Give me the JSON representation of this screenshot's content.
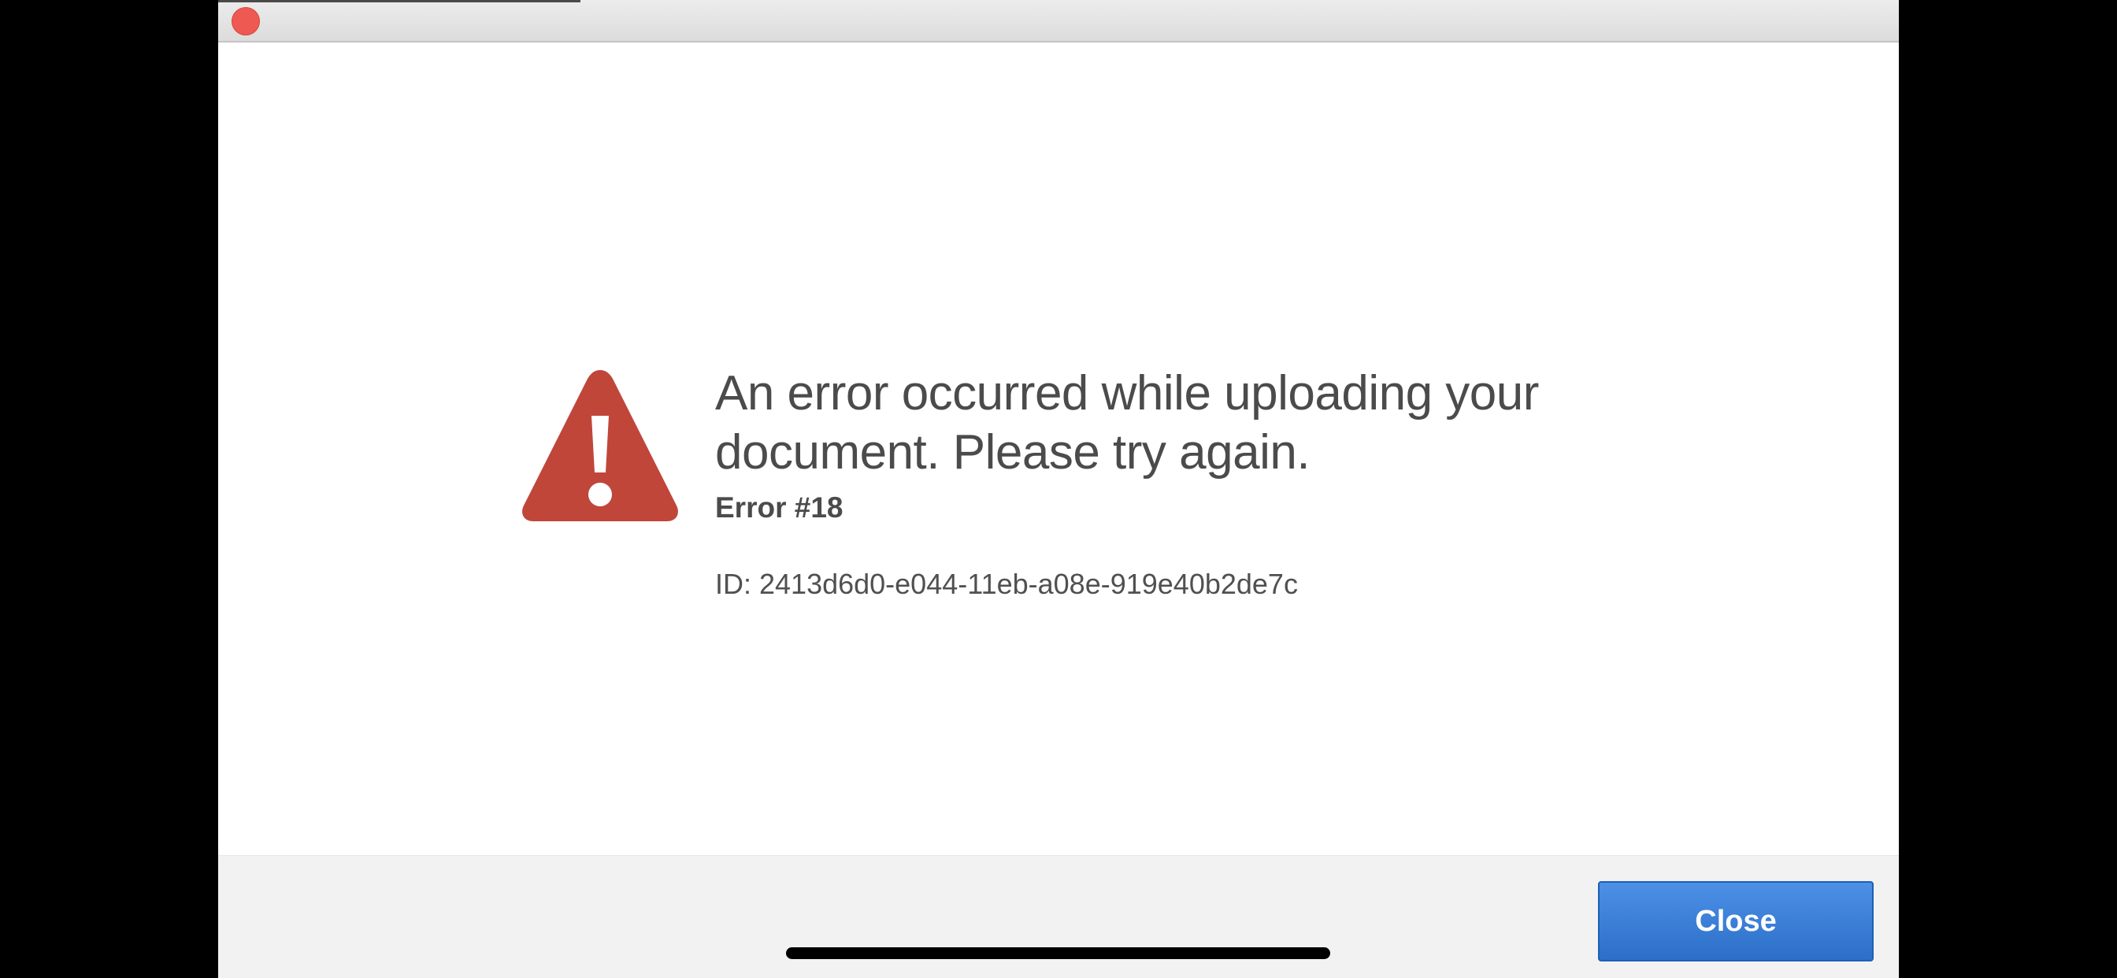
{
  "window": {
    "close_control": "close-window"
  },
  "dialog": {
    "icon": "warning-triangle-icon",
    "icon_color": "#c0463a",
    "headline_line1": "An error occurred while uploading your",
    "headline_line2": "document. Please try again.",
    "error_code": "Error #18",
    "error_id": "ID: 2413d6d0-e044-11eb-a08e-919e40b2de7c"
  },
  "footer": {
    "close_label": "Close",
    "button_color": "#3a7fd8"
  }
}
